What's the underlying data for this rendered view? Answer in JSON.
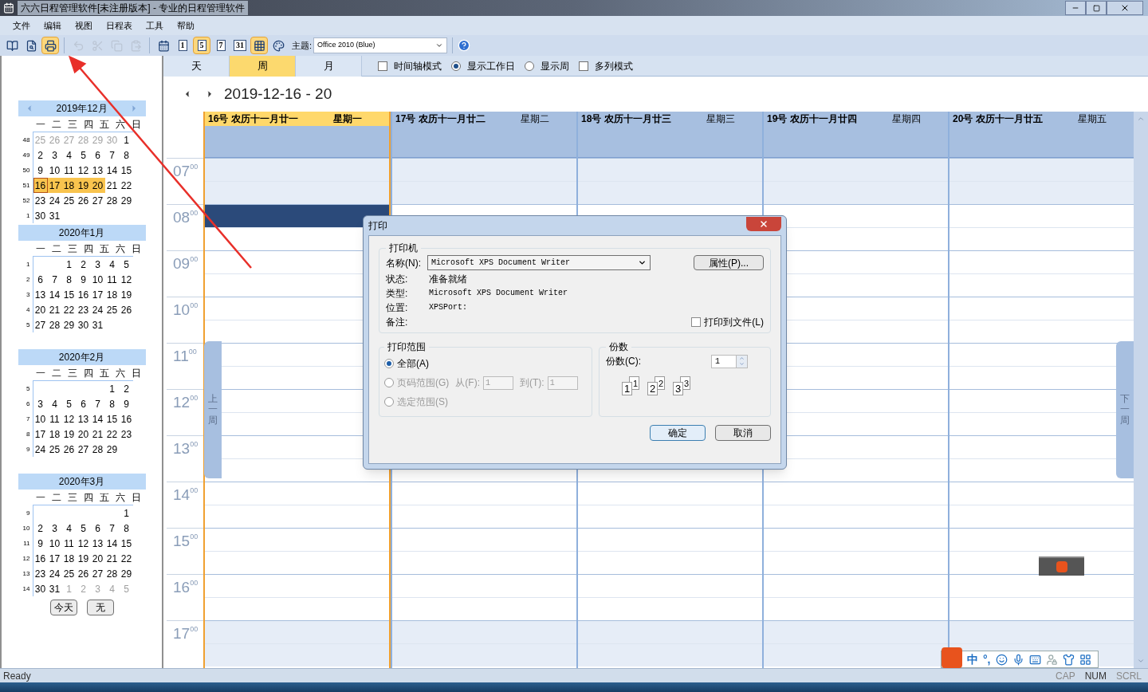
{
  "window": {
    "title": "六六日程管理软件[未注册版本] - 专业的日程管理软件"
  },
  "menu": [
    "文件",
    "编辑",
    "视图",
    "日程表",
    "工具",
    "帮助"
  ],
  "toolbar": {
    "buttons": [
      {
        "kind": "icon",
        "selected": false,
        "disabled": false
      },
      {
        "kind": "icon",
        "selected": false,
        "disabled": false
      },
      {
        "kind": "icon",
        "selected": true,
        "disabled": false
      },
      {
        "kind": "separator"
      },
      {
        "kind": "icon",
        "selected": false,
        "disabled": true
      },
      {
        "kind": "icon",
        "selected": false,
        "disabled": true
      },
      {
        "kind": "icon",
        "selected": false,
        "disabled": true
      },
      {
        "kind": "icon",
        "selected": false,
        "disabled": true
      },
      {
        "kind": "separator"
      },
      {
        "kind": "icon",
        "selected": false,
        "disabled": false
      },
      {
        "kind": "number",
        "text": "1",
        "selected": false,
        "disabled": false
      },
      {
        "kind": "number",
        "text": "5",
        "selected": true,
        "disabled": false
      },
      {
        "kind": "number",
        "text": "7",
        "selected": false,
        "disabled": false
      },
      {
        "kind": "number",
        "text": "31",
        "selected": false,
        "disabled": false
      },
      {
        "kind": "icon",
        "selected": true,
        "disabled": false
      },
      {
        "kind": "icon",
        "selected": false,
        "disabled": false
      }
    ],
    "theme_label": "主题:",
    "theme_value": "Office 2010 (Blue)"
  },
  "sidebar": {
    "months": [
      {
        "title": "2019年12月",
        "arrows": true,
        "weekdays": [
          "一",
          "二",
          "三",
          "四",
          "五",
          "六",
          "日"
        ],
        "weeks": [
          {
            "num": "48",
            "muted_before": [
              "25",
              "26",
              "27",
              "28",
              "29",
              "30"
            ],
            "days": [
              "1"
            ]
          },
          {
            "num": "49",
            "days": [
              "2",
              "3",
              "4",
              "5",
              "6",
              "7",
              "8"
            ]
          },
          {
            "num": "50",
            "days": [
              "9",
              "10",
              "11",
              "12",
              "13",
              "14",
              "15"
            ]
          },
          {
            "num": "51",
            "days": [
              {
                "text": "16",
                "selected": true,
                "today": true
              },
              {
                "text": "17",
                "selected": true,
                "today": false
              },
              {
                "text": "18",
                "selected": true,
                "today": false
              },
              {
                "text": "19",
                "selected": true,
                "today": false
              },
              {
                "text": "20",
                "selected": true,
                "today": false
              },
              {
                "text": "21",
                "selected": false,
                "today": false
              },
              {
                "text": "22",
                "selected": false,
                "today": false
              }
            ]
          },
          {
            "num": "52",
            "days": [
              "23",
              "24",
              "25",
              "26",
              "27",
              "28",
              "29"
            ]
          },
          {
            "num": "1",
            "days": [
              "30",
              "31"
            ]
          }
        ]
      },
      {
        "title": "2020年1月",
        "arrows": false,
        "weekdays": [
          "一",
          "二",
          "三",
          "四",
          "五",
          "六",
          "日"
        ],
        "weeks": [
          {
            "num": "1",
            "days": [
              "1",
              "2",
              "3",
              "4",
              "5"
            ]
          },
          {
            "num": "2",
            "days": [
              "6",
              "7",
              "8",
              "9",
              "10",
              "11",
              "12"
            ]
          },
          {
            "num": "3",
            "days": [
              "13",
              "14",
              "15",
              "16",
              "17",
              "18",
              "19"
            ]
          },
          {
            "num": "4",
            "days": [
              "20",
              "21",
              "22",
              "23",
              "24",
              "25",
              "26"
            ]
          },
          {
            "num": "5",
            "days": [
              "27",
              "28",
              "29",
              "30",
              "31"
            ]
          }
        ]
      },
      {
        "title": "2020年2月",
        "arrows": false,
        "weekdays": [
          "一",
          "二",
          "三",
          "四",
          "五",
          "六",
          "日"
        ],
        "weeks": [
          {
            "num": "5",
            "days": [
              "1",
              "2"
            ]
          },
          {
            "num": "6",
            "days": [
              "3",
              "4",
              "5",
              "6",
              "7",
              "8",
              "9"
            ]
          },
          {
            "num": "7",
            "days": [
              "10",
              "11",
              "12",
              "13",
              "14",
              "15",
              "16"
            ]
          },
          {
            "num": "8",
            "days": [
              "17",
              "18",
              "19",
              "20",
              "21",
              "22",
              "23"
            ]
          },
          {
            "num": "9",
            "days": [
              "24",
              "25",
              "26",
              "27",
              "28",
              "29"
            ]
          }
        ]
      },
      {
        "title": "2020年3月",
        "arrows": false,
        "weekdays": [
          "一",
          "二",
          "三",
          "四",
          "五",
          "六",
          "日"
        ],
        "weeks": [
          {
            "num": "9",
            "days": [
              "1"
            ]
          },
          {
            "num": "10",
            "days": [
              "2",
              "3",
              "4",
              "5",
              "6",
              "7",
              "8"
            ]
          },
          {
            "num": "11",
            "days": [
              "9",
              "10",
              "11",
              "12",
              "13",
              "14",
              "15"
            ]
          },
          {
            "num": "12",
            "days": [
              "16",
              "17",
              "18",
              "19",
              "20",
              "21",
              "22"
            ]
          },
          {
            "num": "13",
            "days": [
              "23",
              "24",
              "25",
              "26",
              "27",
              "28",
              "29"
            ]
          },
          {
            "num": "14",
            "days": [
              "30",
              "31"
            ],
            "muted_after": [
              "1",
              "2",
              "3",
              "4",
              "5"
            ]
          }
        ]
      }
    ],
    "buttons": [
      "今天",
      "无"
    ]
  },
  "view_tabs": [
    {
      "label": "天",
      "selected": false
    },
    {
      "label": "周",
      "selected": true
    },
    {
      "label": "月",
      "selected": false
    }
  ],
  "view_options": [
    {
      "kind": "checkbox",
      "label": "时间轴模式",
      "checked": false
    },
    {
      "kind": "radio",
      "label": "显示工作日",
      "selected": true
    },
    {
      "kind": "radio",
      "label": "显示周",
      "selected": false
    },
    {
      "kind": "checkbox",
      "label": "多列模式",
      "checked": false
    }
  ],
  "range": "2019-12-16 - 20",
  "days": [
    {
      "date": "16号",
      "lunar": "农历十一月廿一",
      "weekday": "星期一",
      "selected": true,
      "busy_hours": [
        false,
        true,
        false,
        false,
        false,
        false,
        false,
        false,
        false,
        false,
        false
      ]
    },
    {
      "date": "17号",
      "lunar": "农历十一月廿二",
      "weekday": "星期二",
      "selected": false
    },
    {
      "date": "18号",
      "lunar": "农历十一月廿三",
      "weekday": "星期三",
      "selected": false
    },
    {
      "date": "19号",
      "lunar": "农历十一月廿四",
      "weekday": "星期四",
      "selected": false
    },
    {
      "date": "20号",
      "lunar": "农历十一月廿五",
      "weekday": "星期五",
      "selected": false
    }
  ],
  "hours": [
    {
      "hour": "07",
      "minute": "00",
      "off_hours": true
    },
    {
      "hour": "08",
      "minute": "00",
      "off_hours": false
    },
    {
      "hour": "09",
      "minute": "00",
      "off_hours": false
    },
    {
      "hour": "10",
      "minute": "00",
      "off_hours": false
    },
    {
      "hour": "11",
      "minute": "00",
      "off_hours": false
    },
    {
      "hour": "12",
      "minute": "00",
      "off_hours": false
    },
    {
      "hour": "13",
      "minute": "00",
      "off_hours": false
    },
    {
      "hour": "14",
      "minute": "00",
      "off_hours": false
    },
    {
      "hour": "15",
      "minute": "00",
      "off_hours": false
    },
    {
      "hour": "16",
      "minute": "00",
      "off_hours": false
    },
    {
      "hour": "17",
      "minute": "00",
      "off_hours": true
    }
  ],
  "prev_week": "上一周",
  "next_week": "下一周",
  "dialog": {
    "title": "打印",
    "printer": {
      "legend": "打印机",
      "name_label": "名称(N):",
      "name_value": "Microsoft XPS Document Writer",
      "properties_button": "属性(P)...",
      "status_label": "状态:",
      "status": "准备就绪",
      "type_label": "类型:",
      "type": "Microsoft XPS Document Writer",
      "where_label": "位置:",
      "where": "XPSPort:",
      "comment_label": "备注:",
      "print_to_file": {
        "label": "打印到文件(L)",
        "checked": false
      }
    },
    "range": {
      "legend": "打印范围",
      "options": [
        {
          "label": "全部(A)",
          "selected": true,
          "disabled": false
        },
        {
          "label": "页码范围(G)",
          "selected": false,
          "disabled": true
        },
        {
          "label": "选定范围(S)",
          "selected": false,
          "disabled": true
        }
      ],
      "from_label": "从(F):",
      "from": "1",
      "to_label": "到(T):",
      "to": "1"
    },
    "copies": {
      "legend": "份数",
      "label": "份数(C):",
      "value": "1",
      "collate": [
        {
          "front": "1",
          "back": "1"
        },
        {
          "front": "2",
          "back": "2"
        },
        {
          "front": "3",
          "back": "3"
        }
      ]
    },
    "ok": "确定",
    "cancel": "取消"
  },
  "ime": {
    "mode": "中",
    "punct": "°,"
  },
  "status_bar": {
    "text": "Ready",
    "indicators": [
      {
        "text": "CAP",
        "on": false
      },
      {
        "text": "NUM",
        "on": true
      },
      {
        "text": "SCRL",
        "on": false
      }
    ]
  }
}
